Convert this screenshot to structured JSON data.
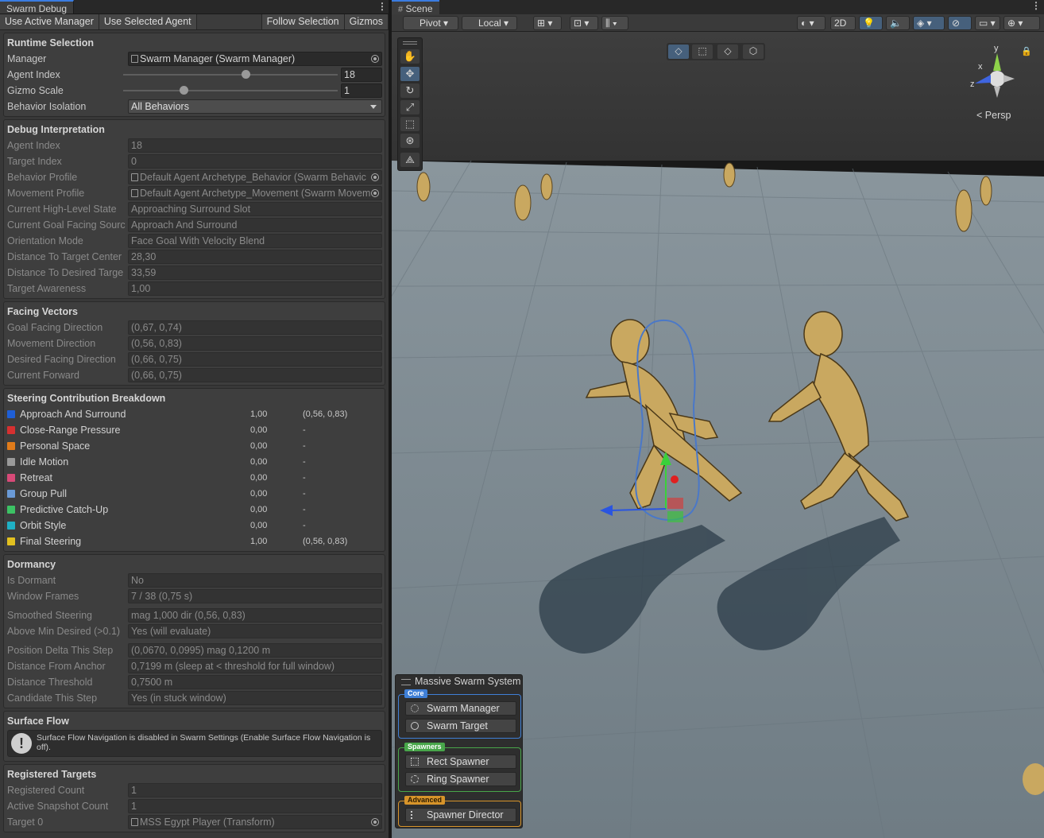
{
  "left_panel": {
    "tab_title": "Swarm Debug",
    "toolbar": {
      "use_active_manager": "Use Active Manager",
      "use_selected_agent": "Use Selected Agent",
      "follow_selection": "Follow Selection",
      "gizmos": "Gizmos"
    },
    "runtime": {
      "header": "Runtime Selection",
      "manager_label": "Manager",
      "manager_value": "Swarm Manager (Swarm Manager)",
      "agent_index_label": "Agent Index",
      "agent_index_value": "18",
      "agent_index_fraction": 0.57,
      "gizmo_scale_label": "Gizmo Scale",
      "gizmo_scale_value": "1",
      "gizmo_scale_fraction": 0.28,
      "behavior_isolation_label": "Behavior Isolation",
      "behavior_isolation_value": "All Behaviors"
    },
    "interpretation": {
      "header": "Debug Interpretation",
      "rows": [
        {
          "label": "Agent Index",
          "value": "18",
          "object": false
        },
        {
          "label": "Target Index",
          "value": "0",
          "object": false
        },
        {
          "label": "Behavior Profile",
          "value": "Default  Agent Archetype_Behavior (Swarm Behavic",
          "object": true
        },
        {
          "label": "Movement Profile",
          "value": "Default  Agent Archetype_Movement (Swarm Movem",
          "object": true
        },
        {
          "label": "Current High-Level State",
          "value": "Approaching Surround Slot",
          "object": false
        },
        {
          "label": "Current Goal Facing Sourc",
          "value": "Approach And Surround",
          "object": false
        },
        {
          "label": "Orientation Mode",
          "value": "Face Goal With Velocity Blend",
          "object": false
        },
        {
          "label": "Distance To Target Center",
          "value": "28,30",
          "object": false
        },
        {
          "label": "Distance To Desired Targe",
          "value": "33,59",
          "object": false
        },
        {
          "label": "Target Awareness",
          "value": "1,00",
          "object": false
        }
      ]
    },
    "facing": {
      "header": "Facing Vectors",
      "rows": [
        {
          "label": "Goal Facing Direction",
          "value": "(0,67, 0,74)"
        },
        {
          "label": "Movement Direction",
          "value": "(0,56, 0,83)"
        },
        {
          "label": "Desired Facing Direction",
          "value": "(0,66, 0,75)"
        },
        {
          "label": "Current Forward",
          "value": "(0,66, 0,75)"
        }
      ]
    },
    "steering": {
      "header": "Steering Contribution Breakdown",
      "rows": [
        {
          "name": "Approach And Surround",
          "weight": "1,00",
          "dir": "(0,56, 0,83)",
          "color": "#1f5fd6"
        },
        {
          "name": "Close-Range Pressure",
          "weight": "0,00",
          "dir": "-",
          "color": "#d63030"
        },
        {
          "name": "Personal Space",
          "weight": "0,00",
          "dir": "-",
          "color": "#e07b1a"
        },
        {
          "name": "Idle Motion",
          "weight": "0,00",
          "dir": "-",
          "color": "#9a9a9a"
        },
        {
          "name": "Retreat",
          "weight": "0,00",
          "dir": "-",
          "color": "#d84a78"
        },
        {
          "name": "Group Pull",
          "weight": "0,00",
          "dir": "-",
          "color": "#6a9ad6"
        },
        {
          "name": "Predictive Catch-Up",
          "weight": "0,00",
          "dir": "-",
          "color": "#3cc264"
        },
        {
          "name": "Orbit Style",
          "weight": "0,00",
          "dir": "-",
          "color": "#1fb0c4"
        },
        {
          "name": "Final Steering",
          "weight": "1,00",
          "dir": "(0,56, 0,83)",
          "color": "#e2c020"
        }
      ]
    },
    "dormancy": {
      "header": "Dormancy",
      "rows_a": [
        {
          "label": "Is Dormant",
          "value": "No"
        },
        {
          "label": "Window Frames",
          "value": "7 / 38  (0,75 s)"
        }
      ],
      "rows_b": [
        {
          "label": "Smoothed Steering",
          "value": "mag 1,000  dir (0,56, 0,83)"
        },
        {
          "label": "Above Min Desired (>0.1)",
          "value": "Yes (will evaluate)"
        }
      ],
      "rows_c": [
        {
          "label": "Position Delta This Step",
          "value": "(0,0670, 0,0995)  mag 0,1200 m"
        },
        {
          "label": "Distance From Anchor",
          "value": "0,7199 m  (sleep at < threshold for full window)"
        },
        {
          "label": "Distance Threshold",
          "value": "0,7500 m"
        },
        {
          "label": "Candidate This Step",
          "value": "Yes (in stuck window)"
        }
      ]
    },
    "surface": {
      "header": "Surface Flow",
      "message": "Surface Flow Navigation is disabled in Swarm Settings (Enable Surface Flow Navigation is off)."
    },
    "targets": {
      "header": "Registered Targets",
      "registered_label": "Registered Count",
      "registered_value": "1",
      "snapshot_label": "Active Snapshot Count",
      "snapshot_value": "1",
      "target0_label": "Target 0",
      "target0_value": "MSS Egypt Player (Transform)"
    }
  },
  "scene": {
    "tab_title": "Scene",
    "pivot": "Pivot",
    "local": "Local",
    "two_d": "2D",
    "persp": "Persp",
    "gizmo_axes": {
      "x": "x",
      "y": "y",
      "z": "z"
    },
    "system_panel": {
      "title": "Massive Swarm System",
      "core_tag": "Core",
      "swarm_manager": "Swarm Manager",
      "swarm_target": "Swarm Target",
      "spawners_tag": "Spawners",
      "rect_spawner": "Rect Spawner",
      "ring_spawner": "Ring Spawner",
      "advanced_tag": "Advanced",
      "spawner_director": "Spawner Director"
    }
  }
}
